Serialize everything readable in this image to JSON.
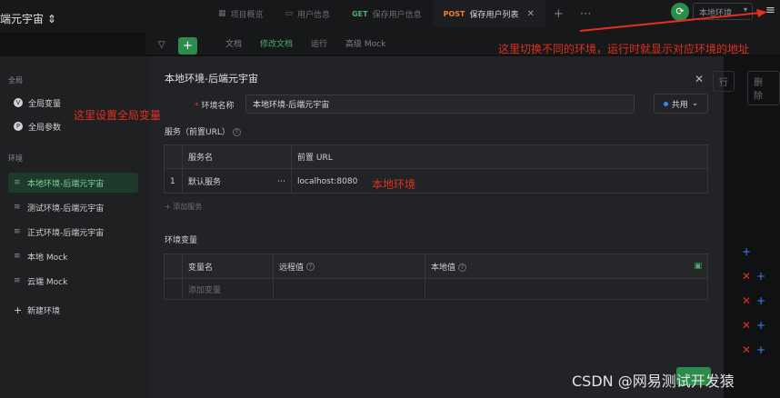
{
  "topbar": {
    "project": "端元宇宙 ⇕",
    "tabs": [
      {
        "method": "",
        "label": "项目概览",
        "icon": "grid-icon"
      },
      {
        "method": "",
        "label": "用户信息",
        "icon": "folder-icon"
      },
      {
        "method": "GET",
        "label": "保存用户信息"
      },
      {
        "method": "POST",
        "label": "保存用户列表",
        "active": true
      }
    ],
    "env_select": "本地环境...",
    "menu_icon": "≡"
  },
  "subtabs": [
    "文档",
    "修改文档",
    "运行",
    "高级 Mock"
  ],
  "annotations": {
    "switch_env": "这里切换不同的环境，运行时就显示对应环境的地址",
    "global_var": "这里设置全局变量",
    "local_env": "本地环境"
  },
  "sidebar": {
    "global_title": "全局",
    "global_items": [
      "全局变量",
      "全局参数"
    ],
    "env_title": "环境",
    "env_items": [
      "本地环境-后端元宇宙",
      "测试环境-后端元宇宙",
      "正式环境-后端元宇宙",
      "本地 Mock",
      "云端 Mock"
    ],
    "new_env": "新建环境"
  },
  "panel": {
    "title": "本地环境-后端元宇宙",
    "name_label": "环境名称",
    "name_value": "本地环境-后端元宇宙",
    "share_label": "共用",
    "services_title": "服务（前置URL）",
    "services_headers": [
      "服务名",
      "前置 URL"
    ],
    "services_rows": [
      {
        "index": "1",
        "name": "默认服务",
        "url": "localhost:8080"
      }
    ],
    "add_service": "+ 添加服务",
    "vars_title": "环境变量",
    "vars_headers": [
      "变量名",
      "远程值",
      "本地值"
    ],
    "vars_placeholder": "添加变量"
  },
  "background": {
    "btn_right": "行",
    "btn_delete": "删 除"
  },
  "watermark": "CSDN @网易测试开发猿",
  "colors": {
    "accent_green": "#2c8c4c",
    "annotation_red": "#e0301e",
    "post_orange": "#e8812d",
    "get_green": "#4caf6e"
  }
}
